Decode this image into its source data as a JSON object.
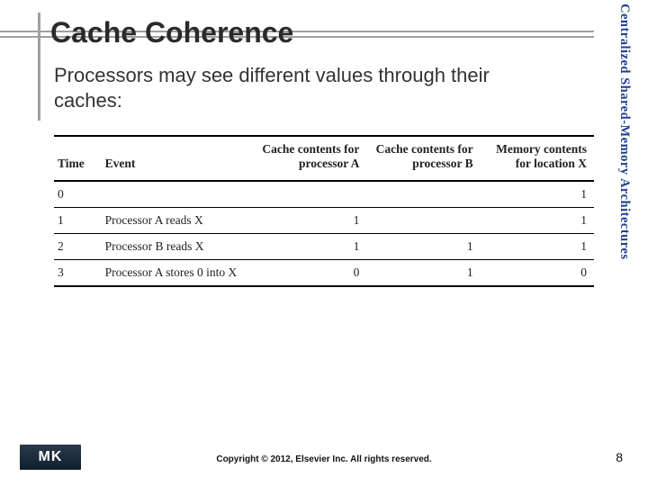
{
  "title": "Cache Coherence",
  "sidebar": "Centralized Shared-Memory Architectures",
  "body_text": "Processors may see different values through their caches:",
  "table": {
    "headers": {
      "time": "Time",
      "event": "Event",
      "cache_a": "Cache contents for processor A",
      "cache_b": "Cache contents for processor B",
      "memory": "Memory contents for location X"
    },
    "rows": [
      {
        "time": "0",
        "event": "",
        "a": "",
        "b": "",
        "m": "1"
      },
      {
        "time": "1",
        "event": "Processor A reads X",
        "a": "1",
        "b": "",
        "m": "1"
      },
      {
        "time": "2",
        "event": "Processor B reads X",
        "a": "1",
        "b": "1",
        "m": "1"
      },
      {
        "time": "3",
        "event": "Processor A stores 0 into X",
        "a": "0",
        "b": "1",
        "m": "0"
      }
    ]
  },
  "footer": {
    "logo": "MK",
    "copyright": "Copyright © 2012, Elsevier Inc. All rights reserved.",
    "page": "8"
  }
}
